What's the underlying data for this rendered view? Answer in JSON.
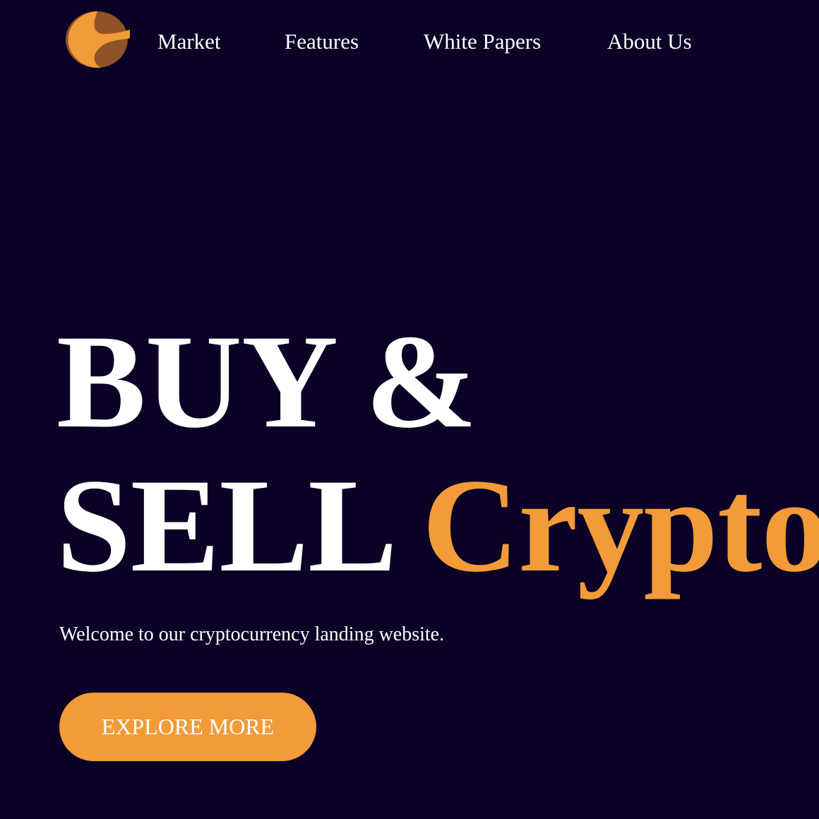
{
  "brand": {
    "logo_icon": "crescent-logo-icon",
    "colors": {
      "background": "#0b0226",
      "accent": "#f29b38",
      "accent_dark": "#8f5327",
      "text": "#ffffff"
    }
  },
  "nav": {
    "items": [
      {
        "label": "Market"
      },
      {
        "label": "Features"
      },
      {
        "label": "White Papers"
      },
      {
        "label": "About Us"
      }
    ]
  },
  "hero": {
    "line1": "BUY &",
    "line2_plain": "SELL",
    "line2_accent": "Crypto",
    "subtitle": "Welcome to our cryptocurrency landing website.",
    "cta_label": "EXPLORE MORE"
  }
}
